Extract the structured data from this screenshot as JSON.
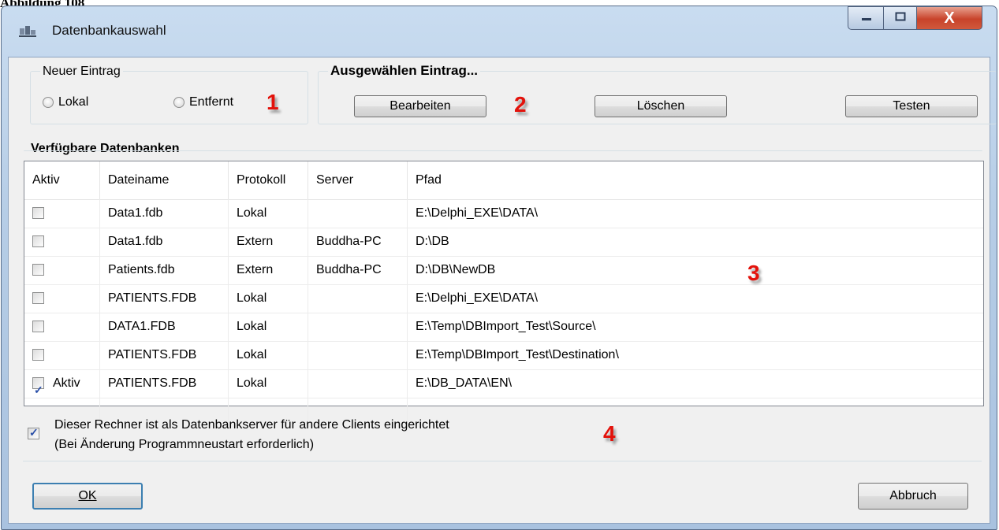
{
  "caption": "Abbildung 108",
  "window": {
    "title": "Datenbankauswahl",
    "minimize_icon": "minimize-icon",
    "maximize_icon": "maximize-icon",
    "close_label": "X"
  },
  "neuer_eintrag": {
    "label": "Neuer Eintrag",
    "lokal": "Lokal",
    "entfernt": "Entfernt"
  },
  "ausgewaehlt": {
    "label": "Ausgewählen Eintrag...",
    "bearbeiten": "Bearbeiten",
    "loeschen": "Löschen",
    "testen": "Testen"
  },
  "section_title": "Verfügbare Datenbanken",
  "columns": [
    "Aktiv",
    "Dateiname",
    "Protokoll",
    "Server",
    "Pfad"
  ],
  "rows": [
    {
      "checked": false,
      "aktiv": "",
      "dateiname": "Data1.fdb",
      "protokoll": "Lokal",
      "server": "",
      "pfad": "E:\\Delphi_EXE\\DATA\\"
    },
    {
      "checked": false,
      "aktiv": "",
      "dateiname": "Data1.fdb",
      "protokoll": "Extern",
      "server": "Buddha-PC",
      "pfad": "D:\\DB"
    },
    {
      "checked": false,
      "aktiv": "",
      "dateiname": "Patients.fdb",
      "protokoll": "Extern",
      "server": "Buddha-PC",
      "pfad": "D:\\DB\\NewDB"
    },
    {
      "checked": false,
      "aktiv": "",
      "dateiname": "PATIENTS.FDB",
      "protokoll": "Lokal",
      "server": "",
      "pfad": "E:\\Delphi_EXE\\DATA\\"
    },
    {
      "checked": false,
      "aktiv": "",
      "dateiname": "DATA1.FDB",
      "protokoll": "Lokal",
      "server": "",
      "pfad": "E:\\Temp\\DBImport_Test\\Source\\"
    },
    {
      "checked": false,
      "aktiv": "",
      "dateiname": "PATIENTS.FDB",
      "protokoll": "Lokal",
      "server": "",
      "pfad": "E:\\Temp\\DBImport_Test\\Destination\\"
    },
    {
      "checked": true,
      "aktiv": "Aktiv",
      "dateiname": "PATIENTS.FDB",
      "protokoll": "Lokal",
      "server": "",
      "pfad": "E:\\DB_DATA\\EN\\"
    }
  ],
  "server_option": {
    "checked": true,
    "line1": "Dieser Rechner ist als Datenbankserver für andere Clients eingerichtet",
    "line2": "(Bei Änderung Programmneustart erforderlich)"
  },
  "buttons": {
    "ok": "OK",
    "abbruch": "Abbruch"
  },
  "annotations": [
    "1",
    "2",
    "3",
    "4"
  ],
  "colors": {
    "annotation": "#e3120b",
    "titlebar": "#b6cde6",
    "client": "#f0f0f0"
  }
}
